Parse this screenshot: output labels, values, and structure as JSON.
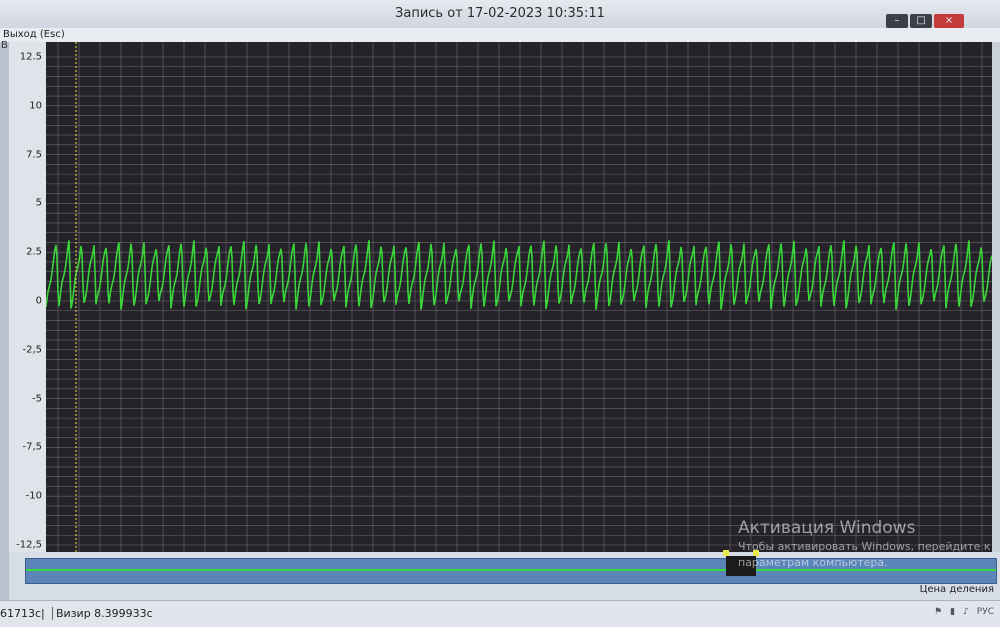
{
  "window": {
    "title": "Запись от 17-02-2023 10:35:11",
    "minimize": "–",
    "maximize": "□",
    "close": "×"
  },
  "menu": {
    "exit": "Выход (Esc)"
  },
  "chart": {
    "unit": "В"
  },
  "overview": {
    "division_label": "Цена деления"
  },
  "watermark": {
    "title": "Активация Windows",
    "line1": "Чтобы активировать Windows, перейдите к",
    "line2": "параметрам компьютера."
  },
  "status": {
    "time": "61713с|",
    "cursor": "Визир 8.399933с"
  },
  "tray": {
    "lang": "РУС"
  },
  "colors": {
    "signal": "#39d539",
    "cursor": "#e8e84a",
    "grid": "#6b6a70",
    "plot_bg": "#252229"
  },
  "chart_data": {
    "type": "line",
    "ylabel": "В",
    "ylim": [
      -12.5,
      12.5
    ],
    "yticks": [
      "12.5",
      "10",
      "7.5",
      "5",
      "2.5",
      "0",
      "-2,5",
      "-5",
      "-7,5",
      "-10",
      "-12,5"
    ],
    "series": [
      {
        "values_description_free": true,
        "pattern": "sawtooth",
        "baseline": 1.2,
        "peak": 3.0,
        "trough": -0.3
      }
    ],
    "cursor_x": 8.399933
  }
}
